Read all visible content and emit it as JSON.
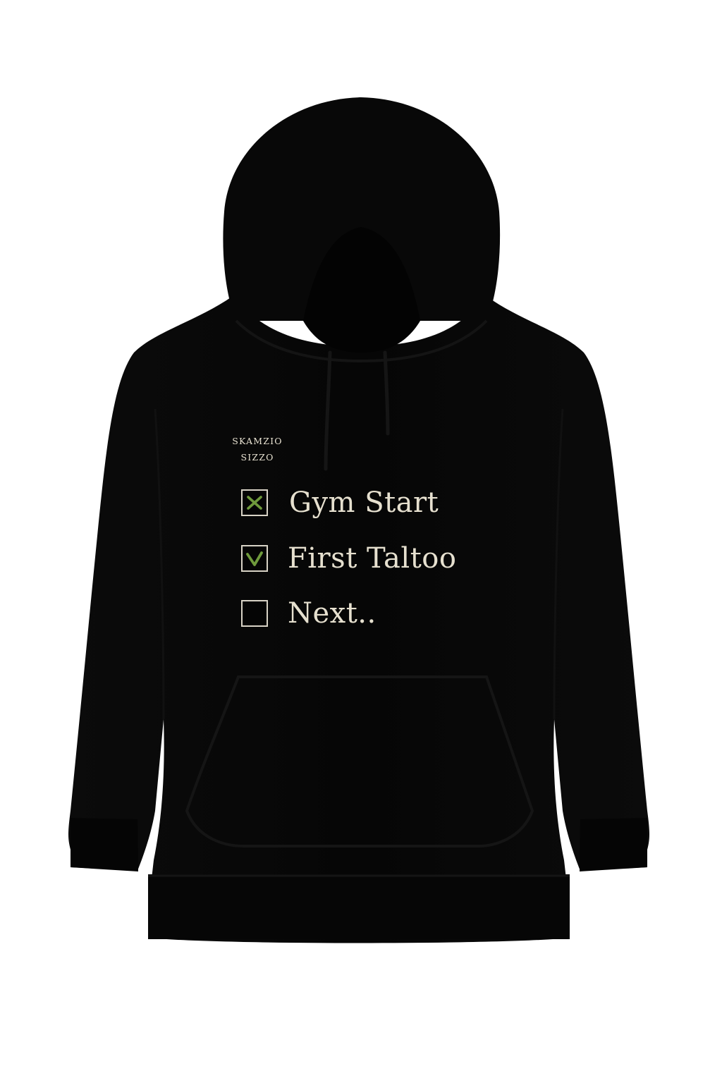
{
  "brand": {
    "line1": "SKAMZIO",
    "line2": "SIZZO"
  },
  "checklist": [
    {
      "label": "Gym Start",
      "mark": "cross",
      "mark_color": "#6f9a3c"
    },
    {
      "label": "First Taltoo",
      "mark": "check",
      "mark_color": "#6f9a3c"
    },
    {
      "label": "Next..",
      "mark": "none"
    }
  ],
  "colors": {
    "garment": "#070707",
    "print": "#e6e0cf",
    "background": "#ffffff"
  }
}
